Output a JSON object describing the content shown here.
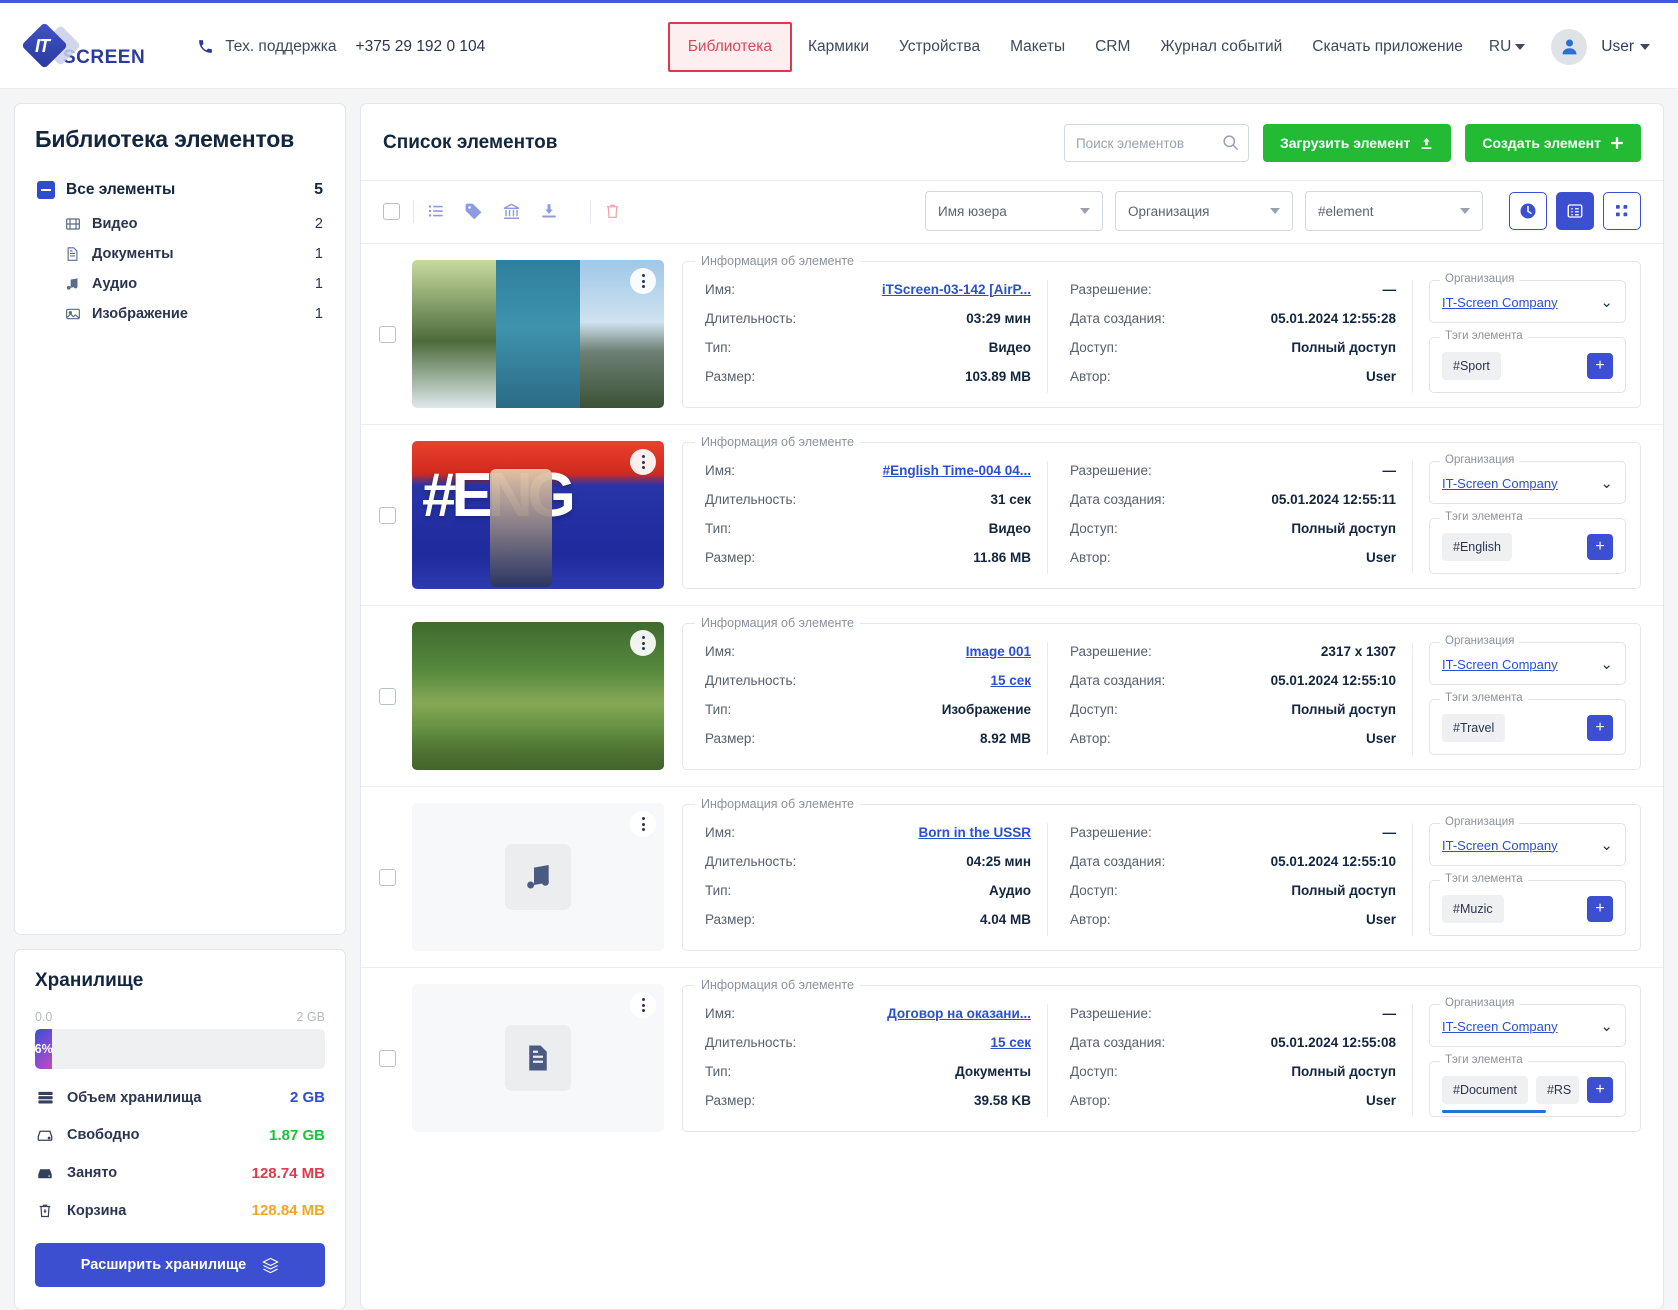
{
  "header": {
    "logo_it": "IT",
    "logo_screen": "SCREEN",
    "support_label": "Тех. поддержка",
    "support_phone": "+375 29 192 0 104",
    "nav": [
      {
        "label": "Библиотека",
        "active": true
      },
      {
        "label": "Кармики",
        "active": false
      },
      {
        "label": "Устройства",
        "active": false
      },
      {
        "label": "Макеты",
        "active": false
      },
      {
        "label": "CRM",
        "active": false
      },
      {
        "label": "Журнал событий",
        "active": false
      },
      {
        "label": "Скачать приложение",
        "active": false
      }
    ],
    "lang": "RU",
    "user": "User",
    "accent_active_border": "#e03a4a",
    "accent_active_bg": "#fdeff0"
  },
  "sidebar": {
    "title": "Библиотека элементов",
    "root": {
      "label": "Все элементы",
      "count": "5"
    },
    "items": [
      {
        "label": "Видео",
        "count": "2",
        "icon": "film-icon"
      },
      {
        "label": "Документы",
        "count": "1",
        "icon": "document-icon"
      },
      {
        "label": "Аудио",
        "count": "1",
        "icon": "music-icon"
      },
      {
        "label": "Изображение",
        "count": "1",
        "icon": "image-icon"
      }
    ]
  },
  "storage": {
    "title": "Хранилище",
    "scale_min": "0.0",
    "scale_max": "2 GB",
    "percent_label": "6%",
    "percent_value": 6,
    "rows": [
      {
        "label": "Объем хранилища",
        "value": "2 GB",
        "color": "#2b4fd0",
        "icon": "server-icon"
      },
      {
        "label": "Свободно",
        "value": "1.87 GB",
        "color": "#18c437",
        "icon": "drive-icon"
      },
      {
        "label": "Занято",
        "value": "128.74 MB",
        "color": "#e03a4a",
        "icon": "drive-full-icon"
      },
      {
        "label": "Корзина",
        "value": "128.84 MB",
        "color": "#f5a623",
        "icon": "trash-icon"
      }
    ],
    "expand_button": "Расширить хранилище"
  },
  "main": {
    "title": "Список элементов",
    "search_placeholder": "Поиск элементов",
    "search_value": "",
    "upload_button": "Загрузить элемент",
    "create_button": "Создать элемент",
    "filters": [
      {
        "label": "Имя юзера",
        "name": "user-name-filter"
      },
      {
        "label": "Организация",
        "name": "organization-filter"
      },
      {
        "label": "#element",
        "name": "tag-filter"
      }
    ],
    "toolbar_icons": [
      "list-icon",
      "tag-icon",
      "bank-icon",
      "download-icon",
      "trash-icon"
    ],
    "view_modes": [
      {
        "name": "recent-view-button",
        "icon": "clock-icon",
        "active": false
      },
      {
        "name": "list-view-button",
        "icon": "list-view-icon",
        "active": true
      },
      {
        "name": "grid-view-button",
        "icon": "grid-view-icon",
        "active": false
      }
    ],
    "info_legend": "Информация об элементе",
    "labels": {
      "name": "Имя:",
      "duration": "Длительность:",
      "type": "Тип:",
      "size": "Размер:",
      "resolution": "Разрешение:",
      "created": "Дата создания:",
      "access": "Доступ:",
      "author": "Автор:",
      "organization": "Организация",
      "tags": "Тэги элемента"
    },
    "items": [
      {
        "name": "iTScreen-03-142 [AirP...",
        "duration": "03:29 мин",
        "duration_link": false,
        "type": "Видео",
        "size": "103.89 MB",
        "resolution": "—",
        "created": "05.01.2024 12:55:28",
        "access": "Полный доступ",
        "author": "User",
        "organization": "IT-Screen Company",
        "tags": [
          "#Sport"
        ],
        "thumb_kind": "video-surf",
        "thumb_scroll": false
      },
      {
        "name": "#English Time-004 04...",
        "duration": "31 сек",
        "duration_link": false,
        "type": "Видео",
        "size": "11.86 MB",
        "resolution": "—",
        "created": "05.01.2024 12:55:11",
        "access": "Полный доступ",
        "author": "User",
        "organization": "IT-Screen Company",
        "tags": [
          "#English"
        ],
        "thumb_kind": "video-eng",
        "thumb_scroll": false
      },
      {
        "name": "Image 001",
        "duration": "15 сек",
        "duration_link": true,
        "type": "Изображение",
        "size": "8.92 MB",
        "resolution": "2317 x 1307",
        "created": "05.01.2024 12:55:10",
        "access": "Полный доступ",
        "author": "User",
        "organization": "IT-Screen Company",
        "tags": [
          "#Travel"
        ],
        "thumb_kind": "image-forest",
        "thumb_scroll": false
      },
      {
        "name": "Born in the USSR",
        "duration": "04:25 мин",
        "duration_link": false,
        "type": "Аудио",
        "size": "4.04 MB",
        "resolution": "—",
        "created": "05.01.2024 12:55:10",
        "access": "Полный доступ",
        "author": "User",
        "organization": "IT-Screen Company",
        "tags": [
          "#Muzic"
        ],
        "thumb_kind": "audio-placeholder",
        "thumb_scroll": false
      },
      {
        "name": "Договор на оказани...",
        "duration": "15 сек",
        "duration_link": true,
        "type": "Документы",
        "size": "39.58 KB",
        "resolution": "—",
        "created": "05.01.2024 12:55:08",
        "access": "Полный доступ",
        "author": "User",
        "organization": "IT-Screen Company",
        "tags": [
          "#Document",
          "#RS"
        ],
        "thumb_kind": "document-placeholder",
        "thumb_scroll": true
      }
    ]
  }
}
